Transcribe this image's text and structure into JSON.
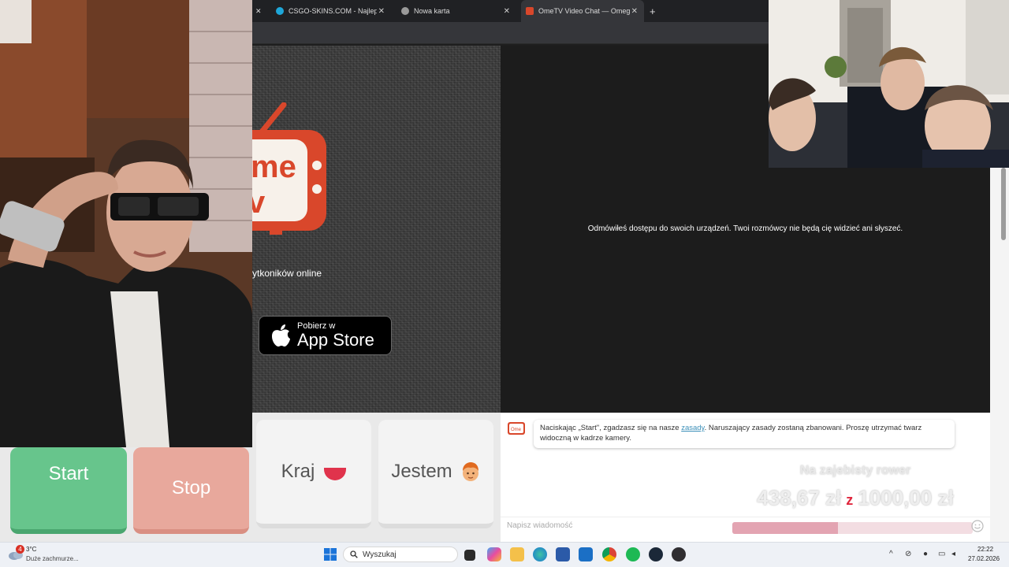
{
  "browser": {
    "tabs": [
      {
        "title": "CSGO-SKINS.COM - Najlepsze",
        "active": false
      },
      {
        "title": "Nowa karta",
        "active": false
      },
      {
        "title": "OmeTV Video Chat — Omegle",
        "active": true
      }
    ],
    "close_glyph": "✕",
    "new_tab_glyph": "+"
  },
  "ometv": {
    "logo_text_1": "me",
    "logo_text_2": "v",
    "users_online_fragment": "ytkoników online",
    "appstore_small": "Pobierz w",
    "appstore_big": "App Store",
    "device_notice": "Odmówiłeś dostępu do swoich urządzeń. Twoi rozmówcy nie będą cię widzieć ani słyszeć.",
    "buttons": {
      "start": "Start",
      "stop": "Stop",
      "country": "Kraj",
      "gender": "Jestem"
    },
    "chat": {
      "rules_before": "Naciskając „Start\", zgadzasz się na nasze ",
      "rules_link": "zasady",
      "rules_after": ". Naruszający zasady zostaną zbanowani. Proszę utrzymać twarz widoczną w kadrze kamery.",
      "placeholder": "Napisz wiadomość"
    }
  },
  "donation_goal": {
    "title": "Na zajebisty rower",
    "current": "438,67 zł",
    "separator": "z",
    "target": "1000,00 zł",
    "progress_fraction": 0.44
  },
  "taskbar": {
    "weather_badge": "4",
    "temperature": "3°C",
    "weather_desc": "Duże zachmurze...",
    "search_label": "Wyszukaj",
    "time": "22:22",
    "date": "27.02.2026"
  },
  "colors": {
    "start_green": "#67c58c",
    "stop_salmon": "#e8a89c",
    "ometv_red": "#d9472b",
    "link_blue": "#3b8fb8"
  }
}
